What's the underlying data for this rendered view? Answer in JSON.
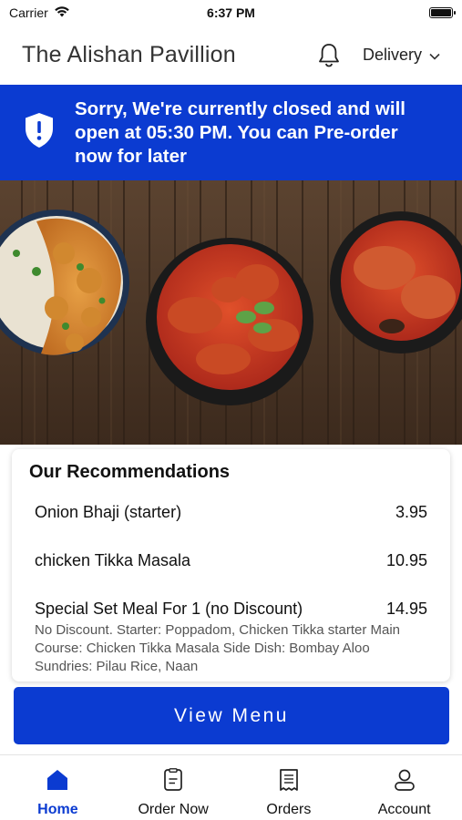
{
  "status_bar": {
    "carrier": "Carrier",
    "time": "6:37 PM"
  },
  "header": {
    "title": "The Alishan Pavillion",
    "bell_icon": "bell-icon",
    "delivery_label": "Delivery"
  },
  "banner": {
    "icon": "shield-alert-icon",
    "message": "Sorry, We're currently closed and will open at 05:30 PM. You can Pre-order now for later"
  },
  "hero": {
    "image": "curry-dishes-photo"
  },
  "recommendations": {
    "title": "Our Recommendations",
    "items": [
      {
        "name": "Onion Bhaji (starter)",
        "price": "3.95",
        "description": ""
      },
      {
        "name": "chicken Tikka Masala",
        "price": "10.95",
        "description": ""
      },
      {
        "name": "Special Set Meal For 1 (no Discount)",
        "price": "14.95",
        "description": "No Discount. Starter: Poppadom, Chicken Tikka starter Main Course: Chicken Tikka Masala Side Dish: Bombay Aloo Sundries: Pilau Rice, Naan"
      }
    ]
  },
  "view_menu_label": "View Menu",
  "tabs": [
    {
      "label": "Home",
      "icon": "home-icon",
      "active": true
    },
    {
      "label": "Order Now",
      "icon": "order-icon",
      "active": false
    },
    {
      "label": "Orders",
      "icon": "receipt-icon",
      "active": false
    },
    {
      "label": "Account",
      "icon": "user-icon",
      "active": false
    }
  ],
  "colors": {
    "accent": "#0b3bd1",
    "text": "#111111",
    "muted": "#555555"
  }
}
